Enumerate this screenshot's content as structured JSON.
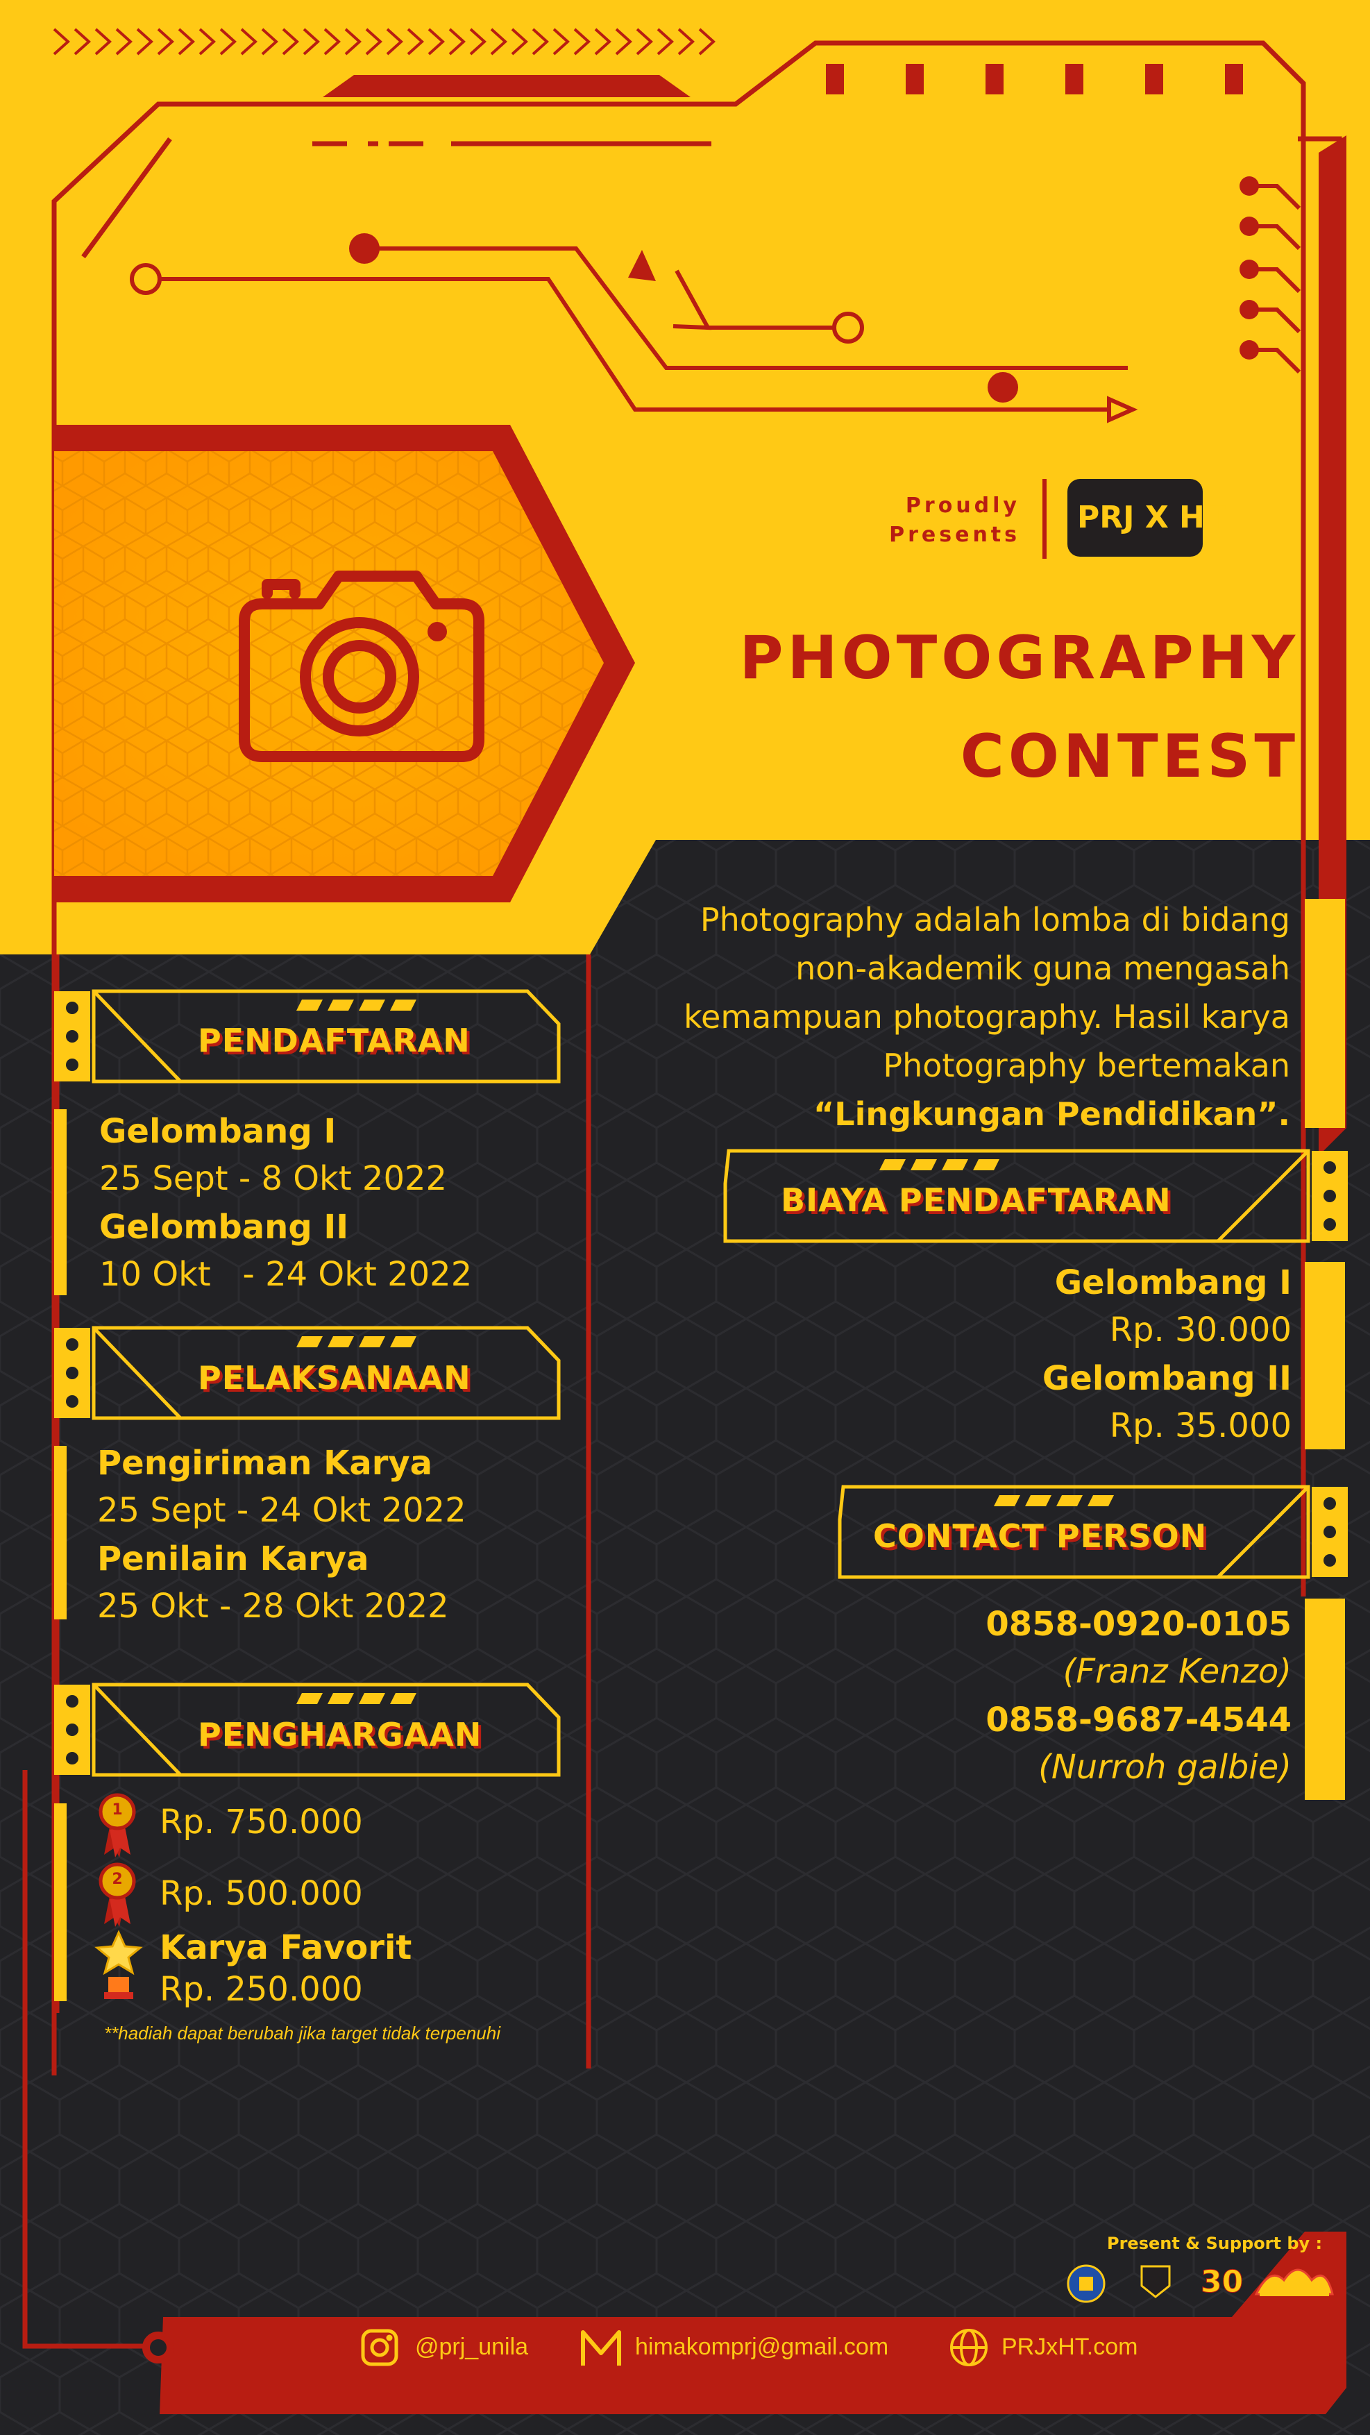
{
  "header": {
    "proudly_line1": "Proudly",
    "proudly_line2": "Presents",
    "logo_text": "PRJ X HT",
    "title_line1": "PHOTOGRAPHY",
    "title_line2": "CONTEST"
  },
  "description": {
    "line1": "Photography adalah lomba di bidang",
    "line2": "non-akademik  guna mengasah",
    "line3": "kemampuan photography. Hasil karya",
    "line4": "Photography bertemakan",
    "theme": "“Lingkungan Pendidikan”."
  },
  "pendaftaran": {
    "heading": "PENDAFTARAN",
    "wave1_label": "Gelombang I",
    "wave1_dates": "25 Sept - 8 Okt 2022",
    "wave2_label": "Gelombang II",
    "wave2_dates": "10 Okt   - 24 Okt 2022"
  },
  "pelaksanaan": {
    "heading": "PELAKSANAAN",
    "submit_label": "Pengiriman Karya",
    "submit_dates": "25 Sept - 24 Okt 2022",
    "judging_label": "Penilain Karya",
    "judging_dates": "25 Okt - 28 Okt 2022"
  },
  "penghargaan": {
    "heading": "PENGHARGAAN",
    "prize1_rank": "1",
    "prize1": "Rp. 750.000",
    "prize2_rank": "2",
    "prize2": "Rp. 500.000",
    "fav_label": "Karya Favorit",
    "fav_prize": "Rp. 250.000",
    "note": "**hadiah dapat berubah jika target tidak terpenuhi"
  },
  "biaya": {
    "heading": "BIAYA PENDAFTARAN",
    "wave1_label": "Gelombang I",
    "wave1_fee": "Rp. 30.000",
    "wave2_label": "Gelombang II",
    "wave2_fee": "Rp. 35.000"
  },
  "contact": {
    "heading": "CONTACT PERSON",
    "phone1": "0858-0920-0105",
    "name1": "(Franz Kenzo)",
    "phone2": "0858-9687-4544",
    "name2": "(Nurroh galbie)"
  },
  "footer": {
    "support_label": "Present & Support by :",
    "instagram": "@prj_unila",
    "email": "himakomprj@gmail.com",
    "website": "PRJxHT.com"
  },
  "colors": {
    "yellow": "#FFC915",
    "red": "#B81D12",
    "dark": "#222225",
    "orange": "#FFA600"
  }
}
